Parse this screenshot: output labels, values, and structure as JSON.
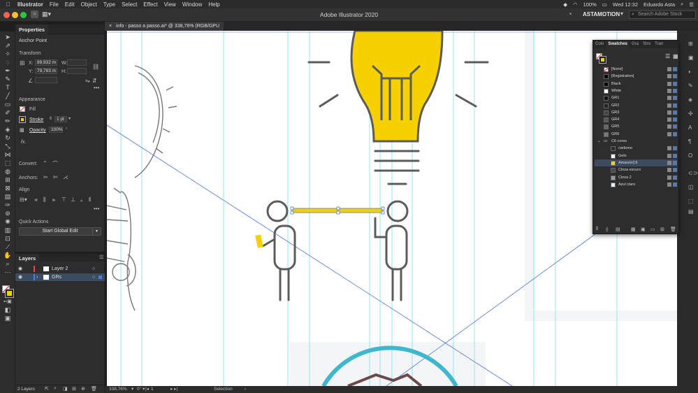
{
  "menubar": {
    "app": "Illustrator",
    "items": [
      "File",
      "Edit",
      "Object",
      "Type",
      "Select",
      "Effect",
      "View",
      "Window",
      "Help"
    ],
    "battery": "100%",
    "datetime": "Wed 12:32",
    "user": "Eduardo Asta"
  },
  "appbar": {
    "title": "Adobe Illustrator 2020",
    "workspace": "ASTAMOTION",
    "search_placeholder": "Search Adobe Stock"
  },
  "doctab": {
    "label": "info - passo a passo.ai* @ 338,76% (RGB/GPU Preview)",
    "close": "×"
  },
  "properties": {
    "tab": "Properties",
    "selection": "Anchor Point",
    "transform_label": "Transform",
    "x_label": "X:",
    "x_value": "89,932 m",
    "y_label": "Y:",
    "y_value": "79,783 m",
    "w_label": "W:",
    "h_label": "H:",
    "appearance_label": "Appearance",
    "fill_label": "Fill",
    "stroke_label": "Stroke",
    "stroke_value": "1 pt",
    "opacity_label": "Opacity",
    "opacity_value": "100%",
    "fx_label": "fx.",
    "convert_label": "Convert:",
    "anchors_label": "Anchors:",
    "align_label": "Align",
    "quick_actions_label": "Quick Actions",
    "global_edit_button": "Start Global Edit"
  },
  "layers": {
    "tab": "Layers",
    "rows": [
      {
        "name": "Layer 2",
        "color": "#e24a4a"
      },
      {
        "name": "GRs",
        "color": "#4a7de2"
      }
    ],
    "count": "2 Layers"
  },
  "swatches": {
    "tabs": [
      "Colo",
      "Swatches",
      "Gra",
      "Stro",
      "Tran"
    ],
    "items": [
      {
        "name": "[None]",
        "color": "none"
      },
      {
        "name": "[Registration]",
        "color": "#000000"
      },
      {
        "name": "Black",
        "color": "#000000"
      },
      {
        "name": "White",
        "color": "#ffffff"
      },
      {
        "name": "GR1",
        "color": "#111111"
      },
      {
        "name": "GR2",
        "color": "#222222"
      },
      {
        "name": "GR3",
        "color": "#444444"
      },
      {
        "name": "GR4",
        "color": "#555555"
      },
      {
        "name": "GR5",
        "color": "#666666"
      },
      {
        "name": "GR6",
        "color": "#777777"
      }
    ],
    "group": "C6 cores",
    "group_items": [
      {
        "name": "carbono",
        "color": "#2d2d2d"
      },
      {
        "name": "Gelo",
        "color": "#f2f2f2"
      },
      {
        "name": "AmareloC6",
        "color": "#f6d000"
      },
      {
        "name": "Cinza escuro",
        "color": "#4a4a4a"
      },
      {
        "name": "Cinza 2",
        "color": "#9a9a9a"
      },
      {
        "name": "Azul claro",
        "color": "#e6ecef"
      }
    ]
  },
  "status": {
    "zoom": "338,76%",
    "angle": "0°",
    "artboard": "1",
    "tool": "Selection"
  },
  "colors": {
    "bulb_yellow": "#f6d000",
    "bulb_gray": "#5b5b5b",
    "guide": "#7fe0ee",
    "circle_teal": "#3fb7cc"
  }
}
